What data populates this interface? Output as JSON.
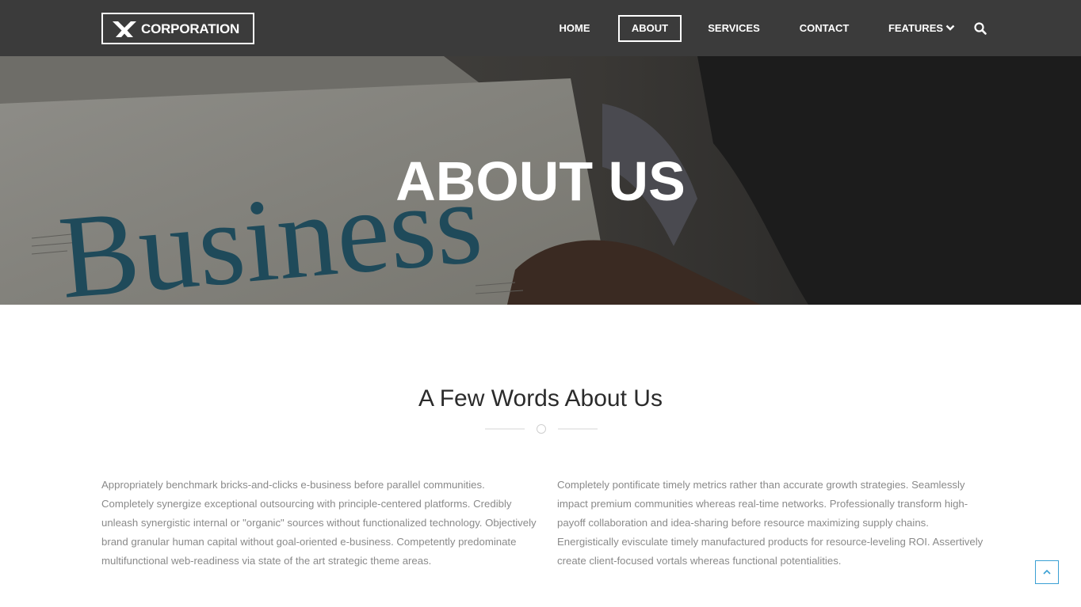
{
  "brand": {
    "name": "CORPORATION"
  },
  "nav": {
    "items": [
      {
        "label": "HOME"
      },
      {
        "label": "ABOUT",
        "active": true
      },
      {
        "label": "SERVICES"
      },
      {
        "label": "CONTACT"
      },
      {
        "label": "FEATURES",
        "icon": "chevron-down-icon"
      }
    ],
    "search_icon": "search-icon"
  },
  "hero": {
    "title": "ABOUT US",
    "image_text": "Business"
  },
  "about": {
    "heading": "A Few Words About Us",
    "paragraphs": [
      "Appropriately benchmark bricks-and-clicks e-business before parallel communities. Completely synergize exceptional outsourcing with principle-centered platforms. Credibly unleash synergistic internal or \"organic\" sources without functionalized technology. Objectively brand granular human capital without goal-oriented e-business. Competently predominate multifunctional web-readiness via state of the art strategic theme areas.",
      "Completely pontificate timely metrics rather than accurate growth strategies. Seamlessly impact premium communities whereas real-time networks. Professionally transform high-payoff collaboration and idea-sharing before resource maximizing supply chains. Energistically evisculate timely manufactured products for resource-leveling ROI. Assertively create client-focused vortals whereas functional potentialities."
    ]
  },
  "back_to_top": {
    "icon": "chevron-up-icon"
  },
  "colors": {
    "navbar": "#3b3b3b",
    "accent": "#3aa0d4",
    "body_text": "#8a8a8a",
    "heading": "#2b2b2b"
  }
}
